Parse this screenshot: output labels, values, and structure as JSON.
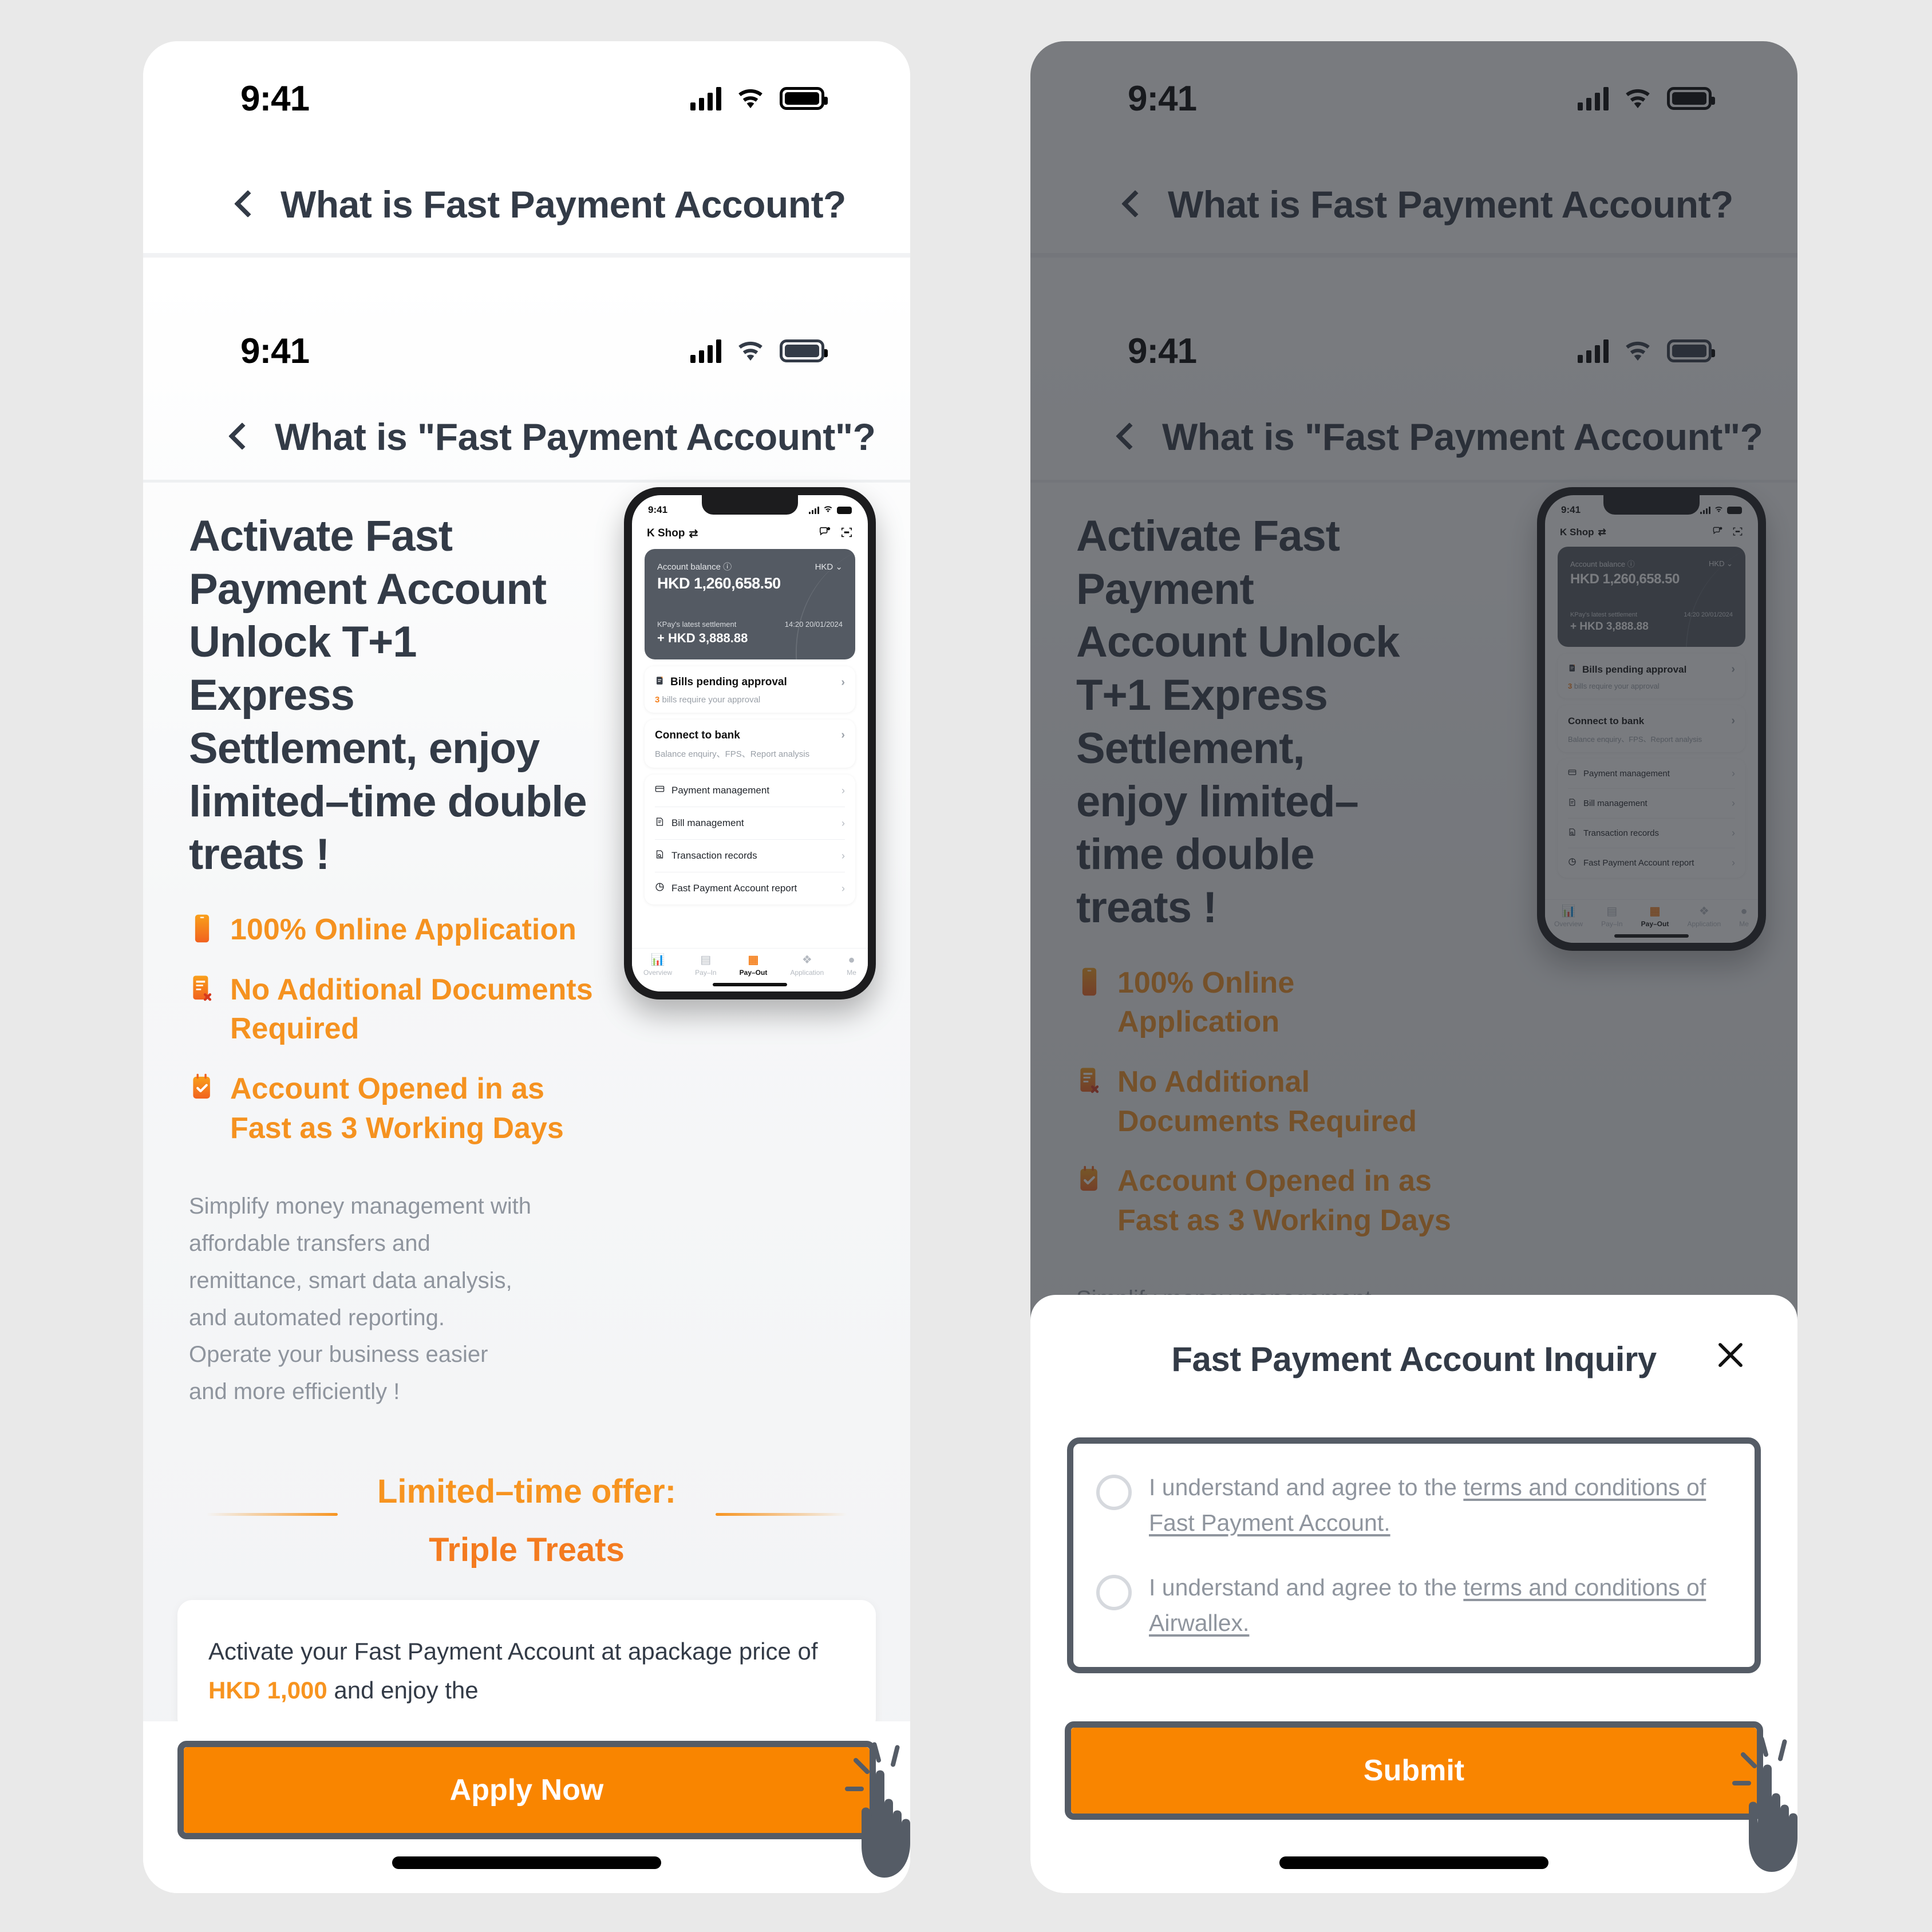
{
  "theme": {
    "accent_orange": "#f79420",
    "cta_orange": "#f98500",
    "outline_gray": "#555c66",
    "text_dark": "#333b47",
    "text_muted": "#8f959e",
    "page_bg": "#e9e9e9"
  },
  "status_bar": {
    "time": "9:41"
  },
  "outer_nav": {
    "title": "What is Fast Payment Account?",
    "back_icon": "chevron-left-icon"
  },
  "inner_nav": {
    "title": "What is \"Fast Payment Account\"?",
    "back_icon": "chevron-left-icon"
  },
  "content": {
    "headline": "Activate Fast Payment Account Unlock T+1 Express Settlement, enjoy limited–time double treats !",
    "features": [
      {
        "icon": "mobile-phone-icon",
        "label": "100% Online Application"
      },
      {
        "icon": "document-no-icon",
        "label": "No Additional Documents Required"
      },
      {
        "icon": "calendar-check-icon",
        "label": "Account Opened in as Fast as 3 Working Days"
      }
    ],
    "paragraph": "Simplify money management with affordable transfers and remittance, smart data analysis, and automated reporting. Operate your business easier and more efficiently !",
    "offer": {
      "line1": "Limited–time offer:",
      "line2": "Triple Treats"
    },
    "offer_card": {
      "prefix": "Activate your Fast Payment Account at apackage price of ",
      "price": "HKD 1,000",
      "suffix": " and enjoy the"
    }
  },
  "left_cta": {
    "label": "Apply Now",
    "cursor_icon": "click-hand-icon"
  },
  "phone_mock": {
    "status_time": "9:41",
    "app_name": "K Shop",
    "switch_icon": "swap-arrows-icon",
    "chat_icon": "chat-bubble-icon",
    "scan_icon": "scan-frame-icon",
    "balance_label": "Account balance",
    "info_icon": "info-circle-icon",
    "currency": "HKD",
    "currency_chevron": "chevron-down-icon",
    "balance_amount": "HKD 1,260,658.50",
    "settlement_label": "KPay's latest settlement",
    "settlement_time": "14:20 20/01/2024",
    "settlement_amount": "+ HKD 3,888.88",
    "bills_card": {
      "icon": "bill-doc-icon",
      "title": "Bills pending approval",
      "sub_count": "3",
      "sub_rest": " bills require your approval",
      "chevron": "chevron-right-icon"
    },
    "bank_card": {
      "title": "Connect to bank",
      "sub": "Balance enquiry、FPS、Report analysis",
      "chevron": "chevron-right-icon"
    },
    "menu": [
      {
        "icon": "payment-card-icon",
        "label": "Payment management"
      },
      {
        "icon": "bill-icon",
        "label": "Bill management"
      },
      {
        "icon": "transaction-search-icon",
        "label": "Transaction records"
      },
      {
        "icon": "pie-chart-icon",
        "label": "Fast Payment Account report"
      }
    ],
    "tabs": [
      {
        "icon": "chart-bar-icon",
        "label": "Overview",
        "active": false
      },
      {
        "icon": "pay-in-icon",
        "label": "Pay–In",
        "active": false
      },
      {
        "icon": "pay-out-card-icon",
        "label": "Pay–Out",
        "active": true
      },
      {
        "icon": "layers-icon",
        "label": "Application",
        "active": false
      },
      {
        "icon": "person-icon",
        "label": "Me",
        "active": false
      }
    ]
  },
  "modal": {
    "title": "Fast Payment Account Inquiry",
    "close_icon": "close-x-icon",
    "agreements": [
      {
        "prefix": "I understand and agree to the ",
        "link": "terms and conditions of Fast Payment Account.",
        "checked": false
      },
      {
        "prefix": "I understand and agree to the ",
        "link": "terms and conditions of Airwallex.",
        "checked": false
      }
    ],
    "submit_label": "Submit",
    "cursor_icon": "click-hand-icon"
  }
}
